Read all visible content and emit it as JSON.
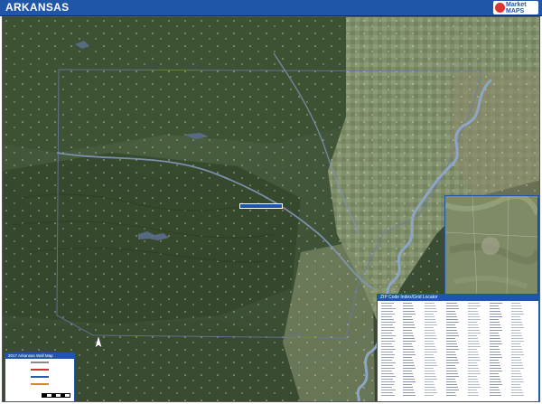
{
  "header": {
    "title": "ARKANSAS"
  },
  "logo": {
    "name_line1": "Market",
    "name_line2": "MAPS"
  },
  "index": {
    "title": "ZIP Code Index/Grid Locator"
  },
  "legend": {
    "title": "2017 Arkansas Wall Map"
  },
  "icons": {
    "compass": "north-arrow-icon",
    "logo": "marketmaps-logo-icon"
  },
  "colors": {
    "brand": "#1f56a8",
    "land": "#3c4f35",
    "river": "#7c93b8",
    "roads": "#d8d8d0",
    "index_bg": "#ffffff"
  }
}
